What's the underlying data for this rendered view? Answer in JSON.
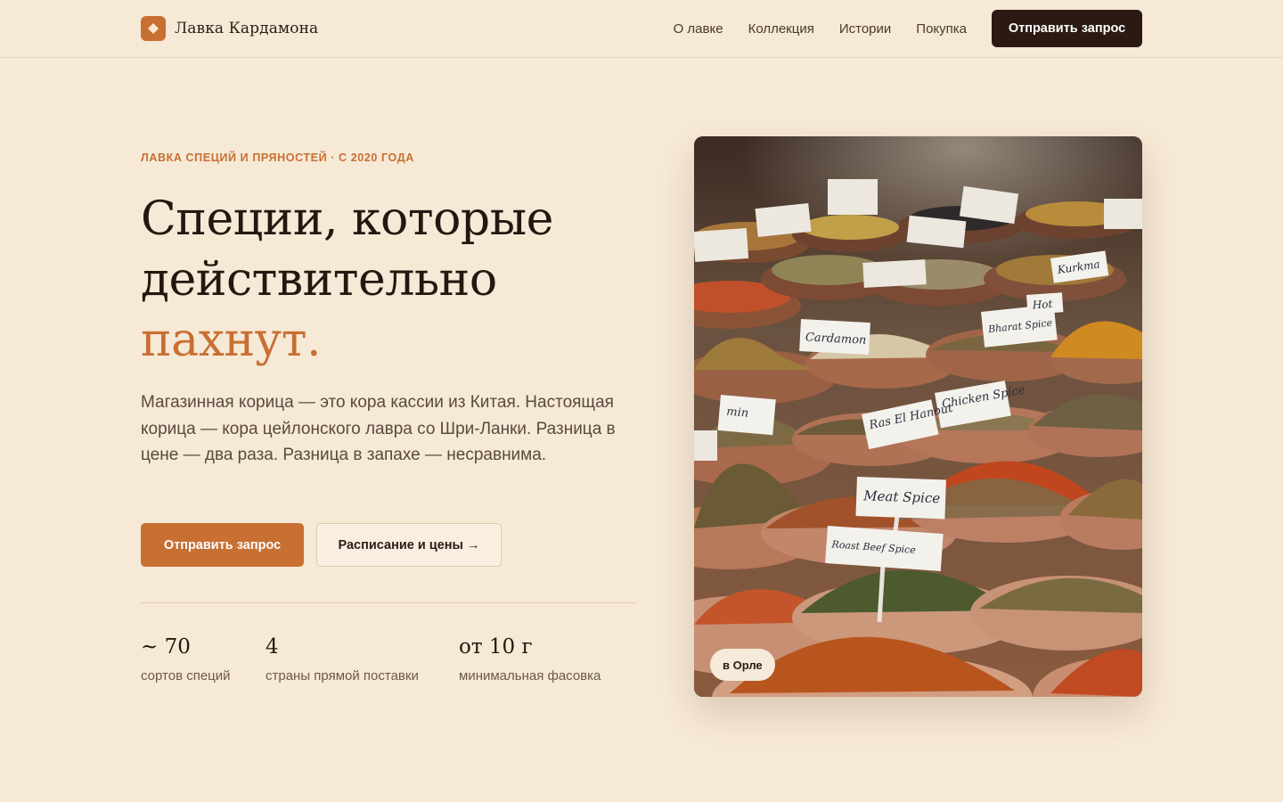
{
  "header": {
    "brand_name": "Лавка Кардамона",
    "nav": [
      "О лавке",
      "Коллекция",
      "Истории",
      "Покупка"
    ],
    "cta_label": "Отправить запрос"
  },
  "hero": {
    "eyebrow": "ЛАВКА СПЕЦИЙ И ПРЯНОСТЕЙ · С 2020 ГОДА",
    "headline": [
      "Специи, которые",
      "действительно",
      "пахнут."
    ],
    "lead": "Магазинная корица — это кора кассии из Китая. Настоящая корица — кора цейлонского лавра со Шри-Ланки. Разница в цене — два раза. Разница в запахе — несравнима.",
    "primary_cta": "Отправить запрос",
    "secondary_cta": "Расписание и цены →",
    "stats": [
      {
        "value": "~ 70",
        "label": "сортов специй"
      },
      {
        "value": "4",
        "label": "страны прямой поставки"
      },
      {
        "value": "от 10 г",
        "label": "минимальная фасовка"
      }
    ],
    "image": {
      "badge": "в Орле",
      "tag_labels": [
        "Cardamon",
        "Chicken Spice",
        "Ras El Hanout",
        "Meat Spice",
        "Roast Beef Spice",
        "Bharat Spice",
        "Hot",
        "Kurkma",
        "min"
      ]
    }
  },
  "colors": {
    "background": "#f6e9d6",
    "accent": "#c86f32",
    "dark": "#2a1a12",
    "text": "#24170f",
    "muted": "#5a4a3e"
  },
  "icons": {
    "brand_mark": "diamond-icon"
  }
}
